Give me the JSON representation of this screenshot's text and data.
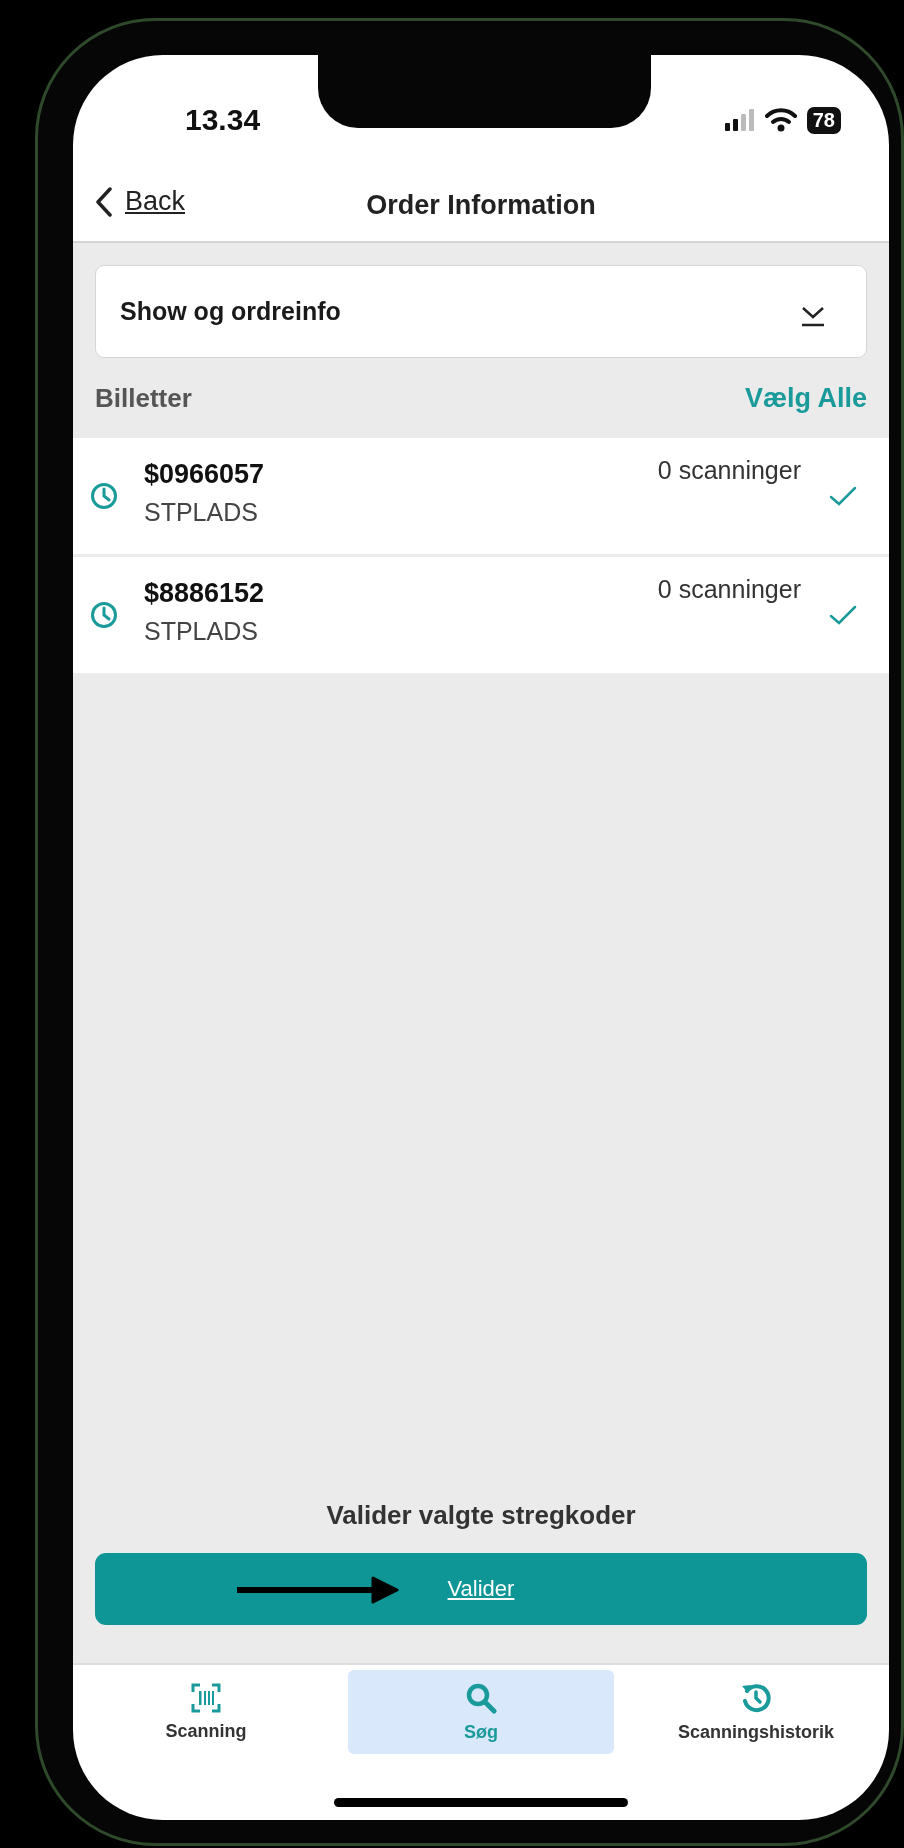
{
  "status_bar": {
    "time": "13.34",
    "battery": "78"
  },
  "header": {
    "back": "Back",
    "title": "Order Information"
  },
  "dropdown": {
    "label": "Show og ordreinfo",
    "expanded": false
  },
  "tickets_section": {
    "title": "Billetter",
    "select_all": "Vælg Alle"
  },
  "tickets": [
    {
      "code": "$0966057",
      "type": "STPLADS",
      "scans": "0 scanninger",
      "checked": true
    },
    {
      "code": "$8886152",
      "type": "STPLADS",
      "scans": "0 scanninger",
      "checked": true
    }
  ],
  "validate": {
    "heading": "Valider valgte stregkoder",
    "button": "Valider"
  },
  "tabs": [
    {
      "kind": "barcode",
      "label": "Scanning",
      "selected": false
    },
    {
      "kind": "search",
      "label": "Søg",
      "selected": true
    },
    {
      "kind": "history",
      "label": "Scanningshistorik",
      "selected": false
    }
  ]
}
